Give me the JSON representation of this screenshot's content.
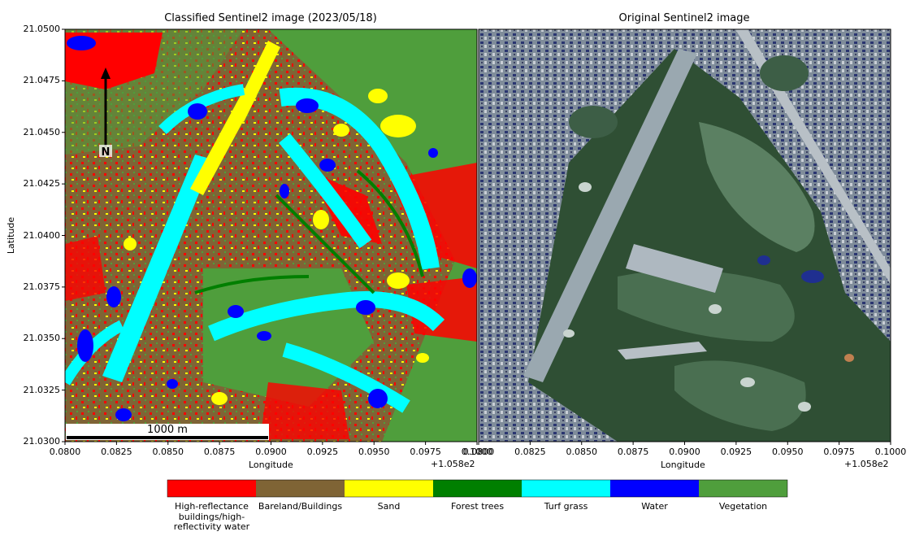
{
  "left_panel": {
    "title": "Classified Sentinel2 image (2023/05/18)",
    "scale_bar_label": "1000 m",
    "north_arrow_label": "N"
  },
  "right_panel": {
    "title": "Original Sentinel2 image"
  },
  "axes": {
    "ylabel": "Latitude",
    "xlabel": "Longitude",
    "x_offset_label": "+1.058e2",
    "y_ticks": [
      "21.0500",
      "21.0475",
      "21.0450",
      "21.0425",
      "21.0400",
      "21.0375",
      "21.0350",
      "21.0325",
      "21.0300"
    ],
    "x_ticks_left": [
      "0.0800",
      "0.0825",
      "0.0850",
      "0.0875",
      "0.0900",
      "0.0925",
      "0.0950",
      "0.0975",
      "0.1000"
    ],
    "x_ticks_right": [
      "0.0800",
      "0.0825",
      "0.0850",
      "0.0875",
      "0.0900",
      "0.0925",
      "0.0950",
      "0.0975",
      "0.1000"
    ]
  },
  "legend": {
    "classes": [
      {
        "label": "High-reflectance buildings/high-reflectivity water",
        "color": "#ff0000"
      },
      {
        "label": "Bareland/Buildings",
        "color": "#7f6435"
      },
      {
        "label": "Sand",
        "color": "#ffff00"
      },
      {
        "label": "Forest trees",
        "color": "#007f00"
      },
      {
        "label": "Turf grass",
        "color": "#00ffff"
      },
      {
        "label": "Water",
        "color": "#0000ff"
      },
      {
        "label": "Vegetation",
        "color": "#4f9e3c"
      }
    ]
  },
  "colors": {
    "satellite_urban": "#7f8c9a",
    "satellite_green": "#2f4f34",
    "satellite_fairway": "#5b8062",
    "satellite_runway": "#9aa8b0"
  }
}
